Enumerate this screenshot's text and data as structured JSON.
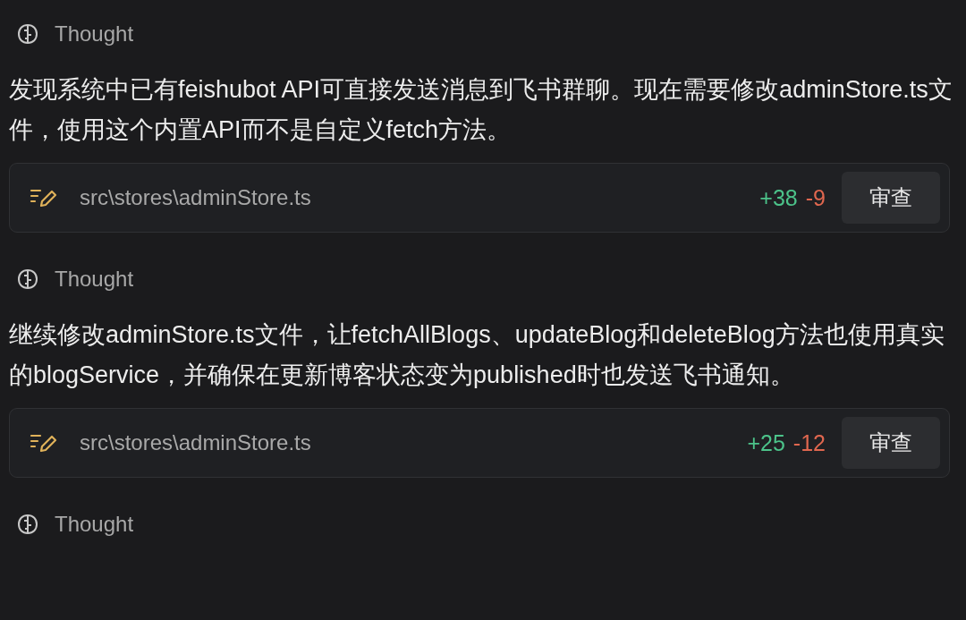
{
  "blocks": [
    {
      "kind": "thought",
      "label": "Thought"
    },
    {
      "kind": "message",
      "text": "发现系统中已有feishubot API可直接发送消息到飞书群聊。现在需要修改adminStore.ts文件，使用这个内置API而不是自定义fetch方法。"
    },
    {
      "kind": "file_edit",
      "path": "src\\stores\\adminStore.ts",
      "added": "+38",
      "removed": "-9",
      "button": "审查"
    },
    {
      "kind": "thought",
      "label": "Thought"
    },
    {
      "kind": "message",
      "text": "继续修改adminStore.ts文件，让fetchAllBlogs、updateBlog和deleteBlog方法也使用真实的blogService，并确保在更新博客状态变为published时也发送飞书通知。"
    },
    {
      "kind": "file_edit",
      "path": "src\\stores\\adminStore.ts",
      "added": "+25",
      "removed": "-12",
      "button": "审查"
    },
    {
      "kind": "thought",
      "label": "Thought"
    }
  ]
}
